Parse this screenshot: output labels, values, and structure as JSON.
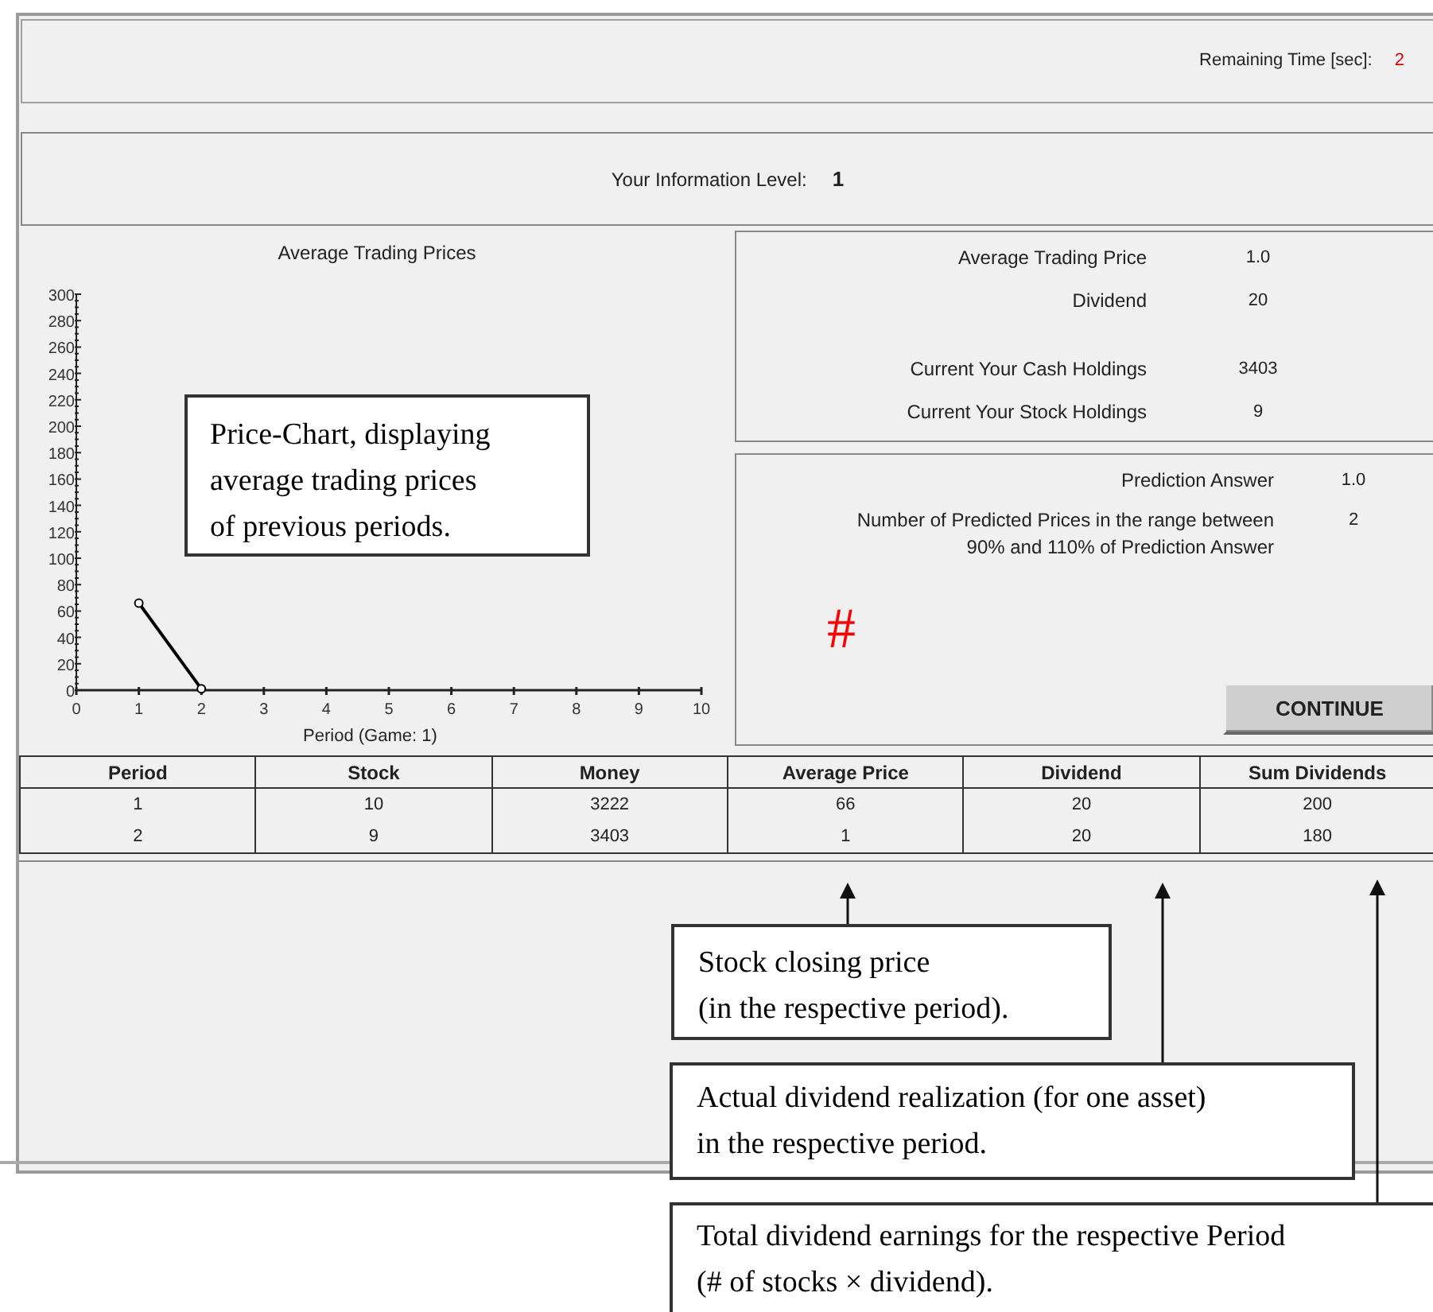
{
  "timer": {
    "label": "Remaining Time [sec]:",
    "value": "2"
  },
  "info_level": {
    "label": "Your Information Level:",
    "value": "1"
  },
  "chart": {
    "chart_data": {
      "type": "line",
      "title": "Average Trading Prices",
      "xlabel": "Period  (Game: 1)",
      "x": [
        1,
        2
      ],
      "series": [
        {
          "color": "#000000",
          "marker": true,
          "values": [
            66,
            1
          ]
        }
      ],
      "xlim": [
        0,
        10
      ],
      "ylim": [
        0,
        300
      ],
      "xticks": [
        0,
        1,
        2,
        3,
        4,
        5,
        6,
        7,
        8,
        9,
        10
      ],
      "yticks": [
        0,
        20,
        40,
        60,
        80,
        100,
        120,
        140,
        160,
        180,
        200,
        220,
        240,
        260,
        280,
        300
      ]
    }
  },
  "summary": [
    [
      {
        "label": "Average Trading Price",
        "value": "1.0"
      },
      {
        "label": "Dividend",
        "value": "20"
      }
    ],
    [
      {
        "label": "Current Your Cash Holdings",
        "value": "3403"
      },
      {
        "label": "Current Your Stock Holdings",
        "value": "9"
      }
    ]
  ],
  "prediction": {
    "rows": [
      {
        "label": "Prediction Answer",
        "value": "1.0"
      },
      {
        "label": "Number of Predicted Prices in the range between\n90% and 110% of Prediction Answer",
        "value": "2"
      }
    ],
    "mark": "#",
    "button": "CONTINUE"
  },
  "table": {
    "columns": [
      "Period",
      "Stock",
      "Money",
      "Average Price",
      "Dividend",
      "Sum Dividends"
    ],
    "rows": [
      [
        "1",
        "10",
        "3222",
        "66",
        "20",
        "200"
      ],
      [
        "2",
        "9",
        "3403",
        "1",
        "20",
        "180"
      ]
    ]
  },
  "annotations": [
    {
      "text": "Price-Chart, displaying\naverage trading prices\nof previous periods."
    },
    {
      "text": "Stock closing price\n(in the respective period)."
    },
    {
      "text": "Actual dividend realization (for one asset)\nin the respective period."
    },
    {
      "text": "Total dividend earnings for the respective Period\n(# of stocks × dividend)."
    }
  ]
}
